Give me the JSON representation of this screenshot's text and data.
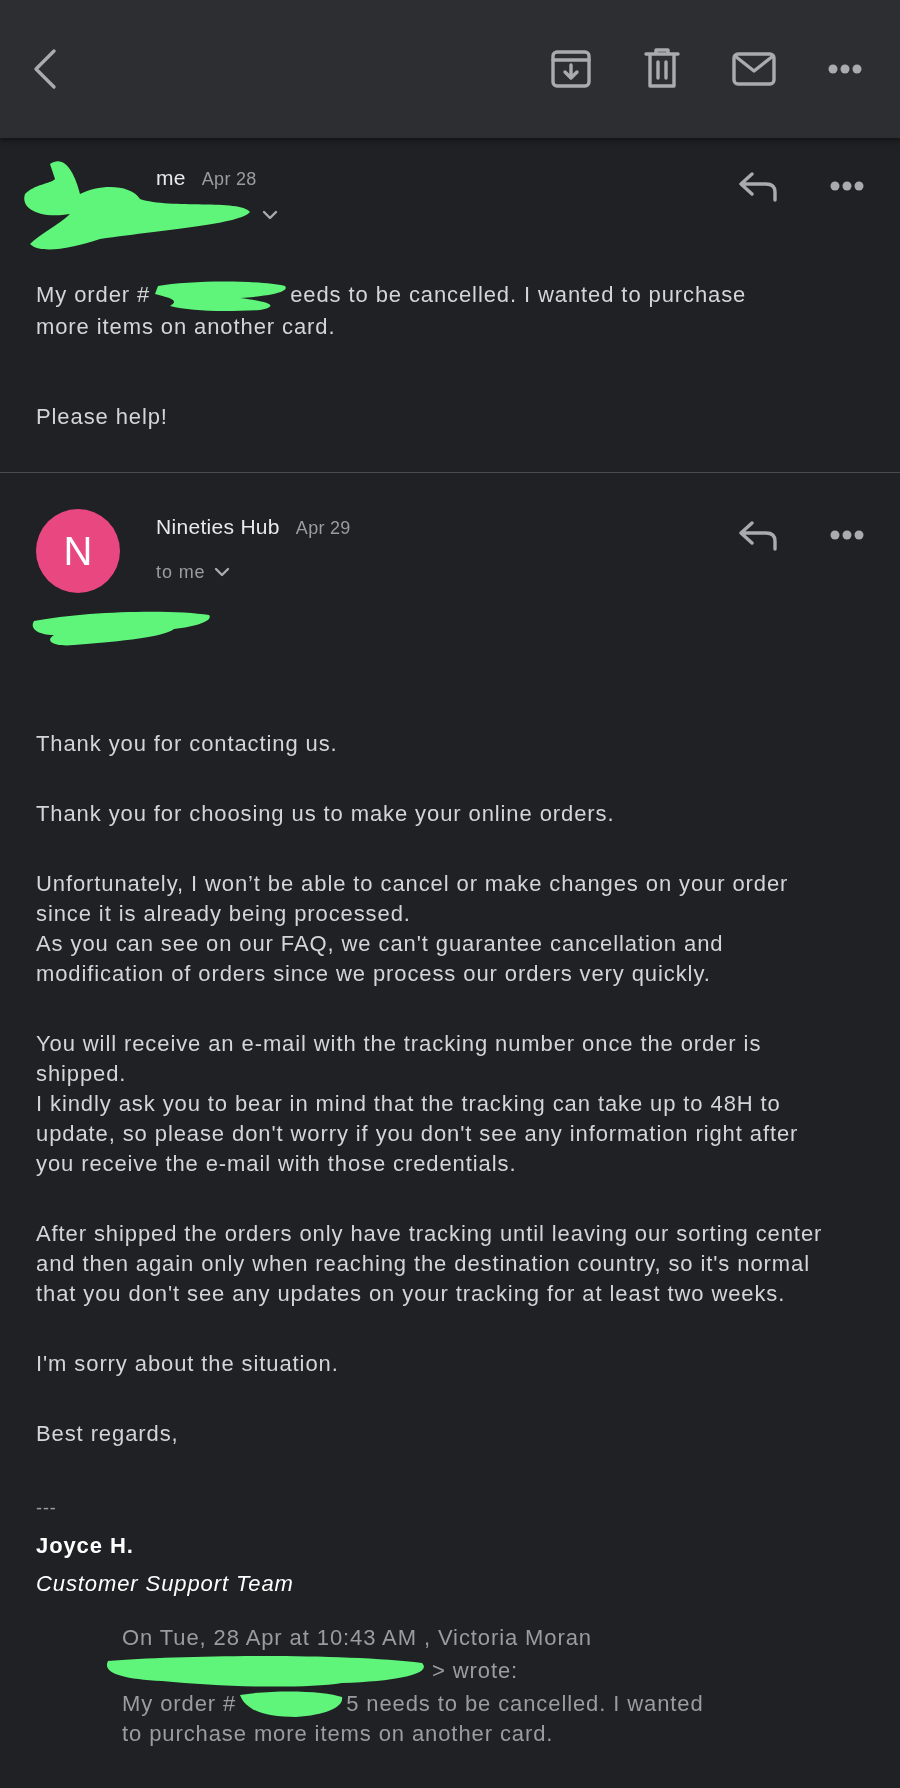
{
  "messages": [
    {
      "sender": "me",
      "date": "Apr 28",
      "expanded": false,
      "avatar": {
        "kind": "redacted"
      },
      "body": [
        {
          "kind": "redacted",
          "before": "My order #",
          "after": "eeds to be cancelled. I wanted to purchase",
          "rest": "more items on another card."
        },
        {
          "kind": "text",
          "lines": [
            "Please help!"
          ]
        }
      ]
    },
    {
      "sender": "Nineties Hub",
      "date": "Apr 29",
      "expanded": false,
      "avatar": {
        "kind": "letter",
        "letter": "N"
      },
      "recipient": "to me",
      "body": [
        {
          "kind": "redaction"
        },
        {
          "kind": "text",
          "lines": [
            "Thank you for contacting us."
          ]
        },
        {
          "kind": "text",
          "lines": [
            "Thank you for choosing us to make your online orders."
          ]
        },
        {
          "kind": "text",
          "lines": [
            "Unfortunately, I won’t be able to cancel or make changes on your order since it is already being processed.",
            "As you can see on our FAQ, we can't guarantee cancellation and modification of orders since we process our orders very quickly."
          ]
        },
        {
          "kind": "text",
          "lines": [
            "You will receive an e-mail with the tracking number once the order is shipped.",
            "I kindly ask you to bear in mind that the tracking can take up to 48H to update, so please don't worry if you don't see any information right after you receive the e-mail with those credentials."
          ]
        },
        {
          "kind": "text",
          "lines": [
            "After shipped the orders only have tracking until leaving our sorting center and then again only when reaching the destination country, so it's normal that you don't see any updates on your tracking for at least two weeks."
          ]
        },
        {
          "kind": "text",
          "lines": [
            "I'm sorry about the situation."
          ]
        },
        {
          "kind": "text",
          "lines": [
            "Best regards,"
          ]
        }
      ],
      "signature": {
        "rule": "---",
        "name": "Joyce H.",
        "team": "Customer Support Team"
      },
      "quote": {
        "header": "On Tue, 28 Apr at 10:43 AM , Victoria Moran",
        "wrote": "> wrote:",
        "before": "My order #",
        "after": "5 needs to be cancelled. I wanted",
        "rest": "to purchase more items on another card."
      }
    }
  ]
}
